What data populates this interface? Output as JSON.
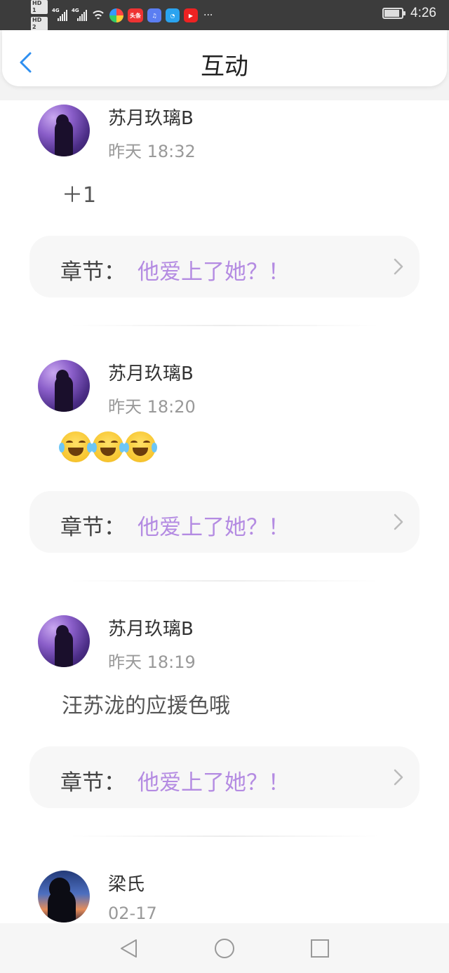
{
  "status_bar": {
    "hd1": "HD 1",
    "hd2": "HD 2",
    "net1": "4G",
    "net2": "4G",
    "app_toutiao": "头条",
    "more": "···",
    "time": "4:26",
    "battery_level": 0.8
  },
  "header": {
    "title": "互动"
  },
  "posts": [
    {
      "username": "苏月玖璃B",
      "time": "昨天 18:32",
      "content": "＋1",
      "chapter_label": "章节：",
      "chapter_title": "他爱上了她？！"
    },
    {
      "username": "苏月玖璃B",
      "time": "昨天 18:20",
      "content": "😂😂😂",
      "chapter_label": "章节：",
      "chapter_title": "他爱上了她？！"
    },
    {
      "username": "苏月玖璃B",
      "time": "昨天 18:19",
      "content": "汪苏泷的应援色哦",
      "chapter_label": "章节：",
      "chapter_title": "他爱上了她？！"
    },
    {
      "username": "梁氏",
      "time": "02-17"
    }
  ],
  "colors": {
    "accent_back": "#2e8ff0",
    "chapter_title": "#b48be2",
    "status_bar": "#3c3c3c"
  }
}
